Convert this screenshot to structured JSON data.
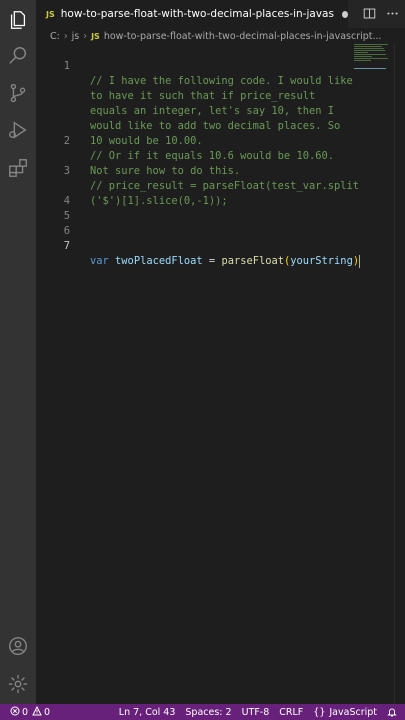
{
  "tab": {
    "badge": "JS",
    "label": "how-to-parse-float-with-two-decimal-places-in-javascript.js"
  },
  "breadcrumbs": {
    "root": "C:",
    "folder": "js",
    "badge": "JS",
    "file": "how-to-parse-float-with-two-decimal-places-in-javascript..."
  },
  "editor": {
    "lines": [
      {
        "n": "1",
        "text": "// I have the following code. I would like"
      },
      {
        "n": "",
        "text": "to have it such that if price_result"
      },
      {
        "n": "",
        "text": "equals an integer, let's say 10, then I"
      },
      {
        "n": "",
        "text": "would like to add two decimal places. So"
      },
      {
        "n": "",
        "text": "10 would be 10.00."
      },
      {
        "n": "2",
        "text": "// Or if it equals 10.6 would be 10.60."
      },
      {
        "n": "",
        "text": "Not sure how to do this."
      },
      {
        "n": "3",
        "text": "// price_result = parseFloat(test_var.split"
      },
      {
        "n": "",
        "text": "('$')[1].slice(0,-1));"
      },
      {
        "n": "4",
        "text": ""
      },
      {
        "n": "5",
        "text": ""
      },
      {
        "n": "6",
        "text": ""
      }
    ],
    "line7": {
      "n": "7",
      "kw": "var",
      "name": "twoPlacedFloat",
      "op": "=",
      "fn": "parseFloat",
      "open": "(",
      "arg": "yourString",
      "close": ")"
    }
  },
  "statusbar": {
    "errors": "0",
    "warnings": "0",
    "position": "Ln 7, Col 43",
    "spaces": "Spaces: 2",
    "encoding": "UTF-8",
    "eol": "CRLF",
    "language": "JavaScript",
    "color": "#68217a"
  },
  "icons": [
    "explorer-icon",
    "search-icon",
    "source-control-icon",
    "run-debug-icon",
    "extensions-icon",
    "account-icon",
    "manage-gear-icon",
    "split-editor-icon",
    "more-actions-icon",
    "error-icon",
    "warning-icon",
    "braces-icon",
    "bell-icon"
  ]
}
